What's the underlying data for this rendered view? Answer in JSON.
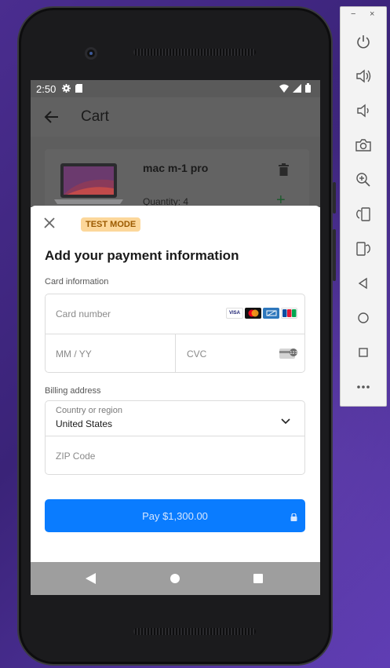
{
  "status_bar": {
    "time": "2:50"
  },
  "app_bar": {
    "title": "Cart"
  },
  "cart": {
    "items": [
      {
        "name": "mac m-1 pro",
        "quantity_text": "Quantity: 4"
      }
    ]
  },
  "payment_sheet": {
    "test_badge": "TEST MODE",
    "title": "Add your payment information",
    "card_section_label": "Card information",
    "card_number_placeholder": "Card number",
    "expiry_placeholder": "MM / YY",
    "cvc_placeholder": "CVC",
    "billing_section_label": "Billing address",
    "country_label": "Country or region",
    "country_value": "United States",
    "zip_placeholder": "ZIP Code",
    "pay_button_label": "Pay $1,300.00",
    "card_brands": [
      "VISA",
      "Mastercard",
      "AMEX",
      "JCB"
    ]
  },
  "emulator_panel": {
    "minimize": "−",
    "close": "×",
    "controls": [
      "power-icon",
      "volume-up-icon",
      "volume-down-icon",
      "rotate-left-icon",
      "rotate-right-icon",
      "camera-icon",
      "zoom-icon",
      "back-icon",
      "home-icon",
      "overview-icon",
      "more-icon"
    ]
  },
  "colors": {
    "pay_button": "#0a7cff",
    "test_badge_bg": "#fcd79a",
    "test_badge_text": "#9b5a00"
  }
}
